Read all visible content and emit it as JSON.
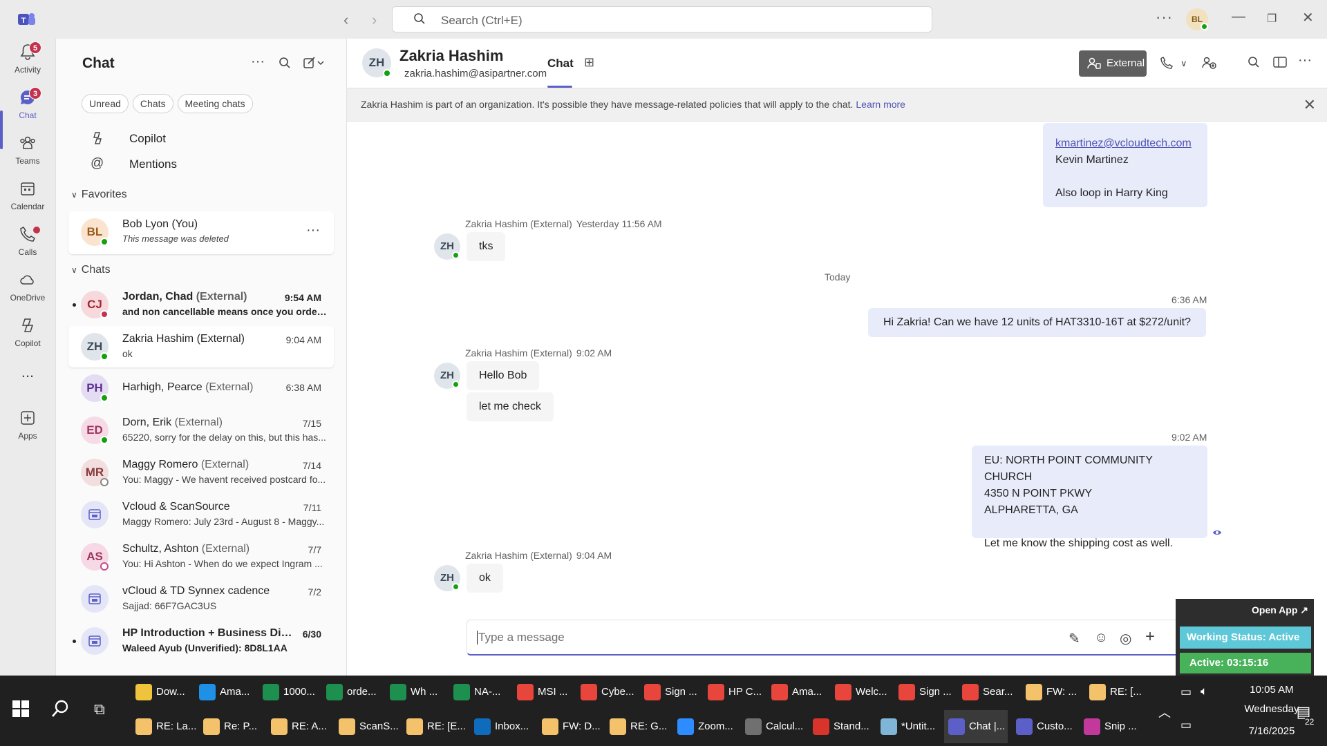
{
  "window": {
    "search_placeholder": "Search (Ctrl+E)",
    "user_initials": "BL"
  },
  "rail": {
    "items": [
      {
        "label": "Activity",
        "badge": "5"
      },
      {
        "label": "Chat",
        "badge": "3"
      },
      {
        "label": "Teams"
      },
      {
        "label": "Calendar"
      },
      {
        "label": "Calls"
      },
      {
        "label": "OneDrive"
      },
      {
        "label": "Copilot"
      },
      {
        "label": "..."
      },
      {
        "label": "Apps"
      }
    ]
  },
  "chatlist": {
    "title": "Chat",
    "filters": [
      "Unread",
      "Chats",
      "Meeting chats"
    ],
    "copilot": "Copilot",
    "mentions": "Mentions",
    "favorites_label": "Favorites",
    "chats_label": "Chats",
    "favorites": [
      {
        "initials": "BL",
        "name": "Bob Lyon (You)",
        "preview": "This message was deleted"
      }
    ],
    "chats": [
      {
        "initials": "CJ",
        "name": "Jordan, Chad",
        "ext": "(External)",
        "time": "9:54 AM",
        "preview": "and non cancellable means once you order, i..."
      },
      {
        "initials": "ZH",
        "name": "Zakria Hashim",
        "ext": "(External)",
        "time": "9:04 AM",
        "preview": "ok"
      },
      {
        "initials": "PH",
        "name": "Harhigh, Pearce",
        "ext": "(External)",
        "time": "6:38 AM",
        "preview": ""
      },
      {
        "initials": "ED",
        "name": "Dorn, Erik",
        "ext": "(External)",
        "time": "7/15",
        "preview": "65220, sorry for the delay on this, but this has..."
      },
      {
        "initials": "MR",
        "name": "Maggy Romero",
        "ext": "(External)",
        "time": "7/14",
        "preview": "You: Maggy - We havent received postcard fo..."
      },
      {
        "initials": "",
        "name": "Vcloud & ScanSource",
        "ext": "",
        "time": "7/11",
        "preview": "Maggy Romero: July 23rd - August 8 - Maggy..."
      },
      {
        "initials": "AS",
        "name": "Schultz, Ashton",
        "ext": "(External)",
        "time": "7/7",
        "preview": "You: Hi Ashton -  When do we expect Ingram ..."
      },
      {
        "initials": "",
        "name": "vCloud & TD Synnex cadence",
        "ext": "",
        "time": "7/2",
        "preview": "Sajjad: 66F7GAC3US"
      },
      {
        "initials": "",
        "name": "HP Introduction + Business Dis...",
        "ext": "",
        "time": "6/30",
        "preview": "Waleed Ayub (Unverified): 8D8L1AA"
      }
    ]
  },
  "conversation": {
    "initials": "ZH",
    "name": "Zakria Hashim",
    "email": "zakria.hashim@asipartner.com",
    "tab": "Chat",
    "external_label": "External",
    "banner": "Zakria Hashim is part of an organization. It's possible they have message-related policies that will apply to the chat.",
    "banner_link": "Learn more",
    "top_bubble": {
      "email": "kmartinez@vcloudtech.com",
      "name": "Kevin Martinez",
      "note": "Also loop in Harry King"
    },
    "sender": "Zakria Hashim (External)",
    "t1": "Yesterday 11:56 AM",
    "m1": "tks",
    "today": "Today",
    "t2": "6:36 AM",
    "m2": "Hi Zakria! Can we have 12 units of HAT3310-16T at $272/unit?",
    "t3": "9:02 AM",
    "m3a": "Hello Bob",
    "m3b": "let me check",
    "t4": "9:02 AM",
    "m4": [
      "EU: NORTH POINT COMMUNITY CHURCH",
      "4350 N POINT PKWY",
      "ALPHARETTA, GA",
      "",
      "Let me know the shipping cost as well."
    ],
    "t5": "9:04 AM",
    "m5": "ok",
    "compose_placeholder": "Type a message"
  },
  "widget": {
    "open": "Open App ↗",
    "status": "Working Status: Active",
    "active": "Active: 03:15:16"
  },
  "taskbar": {
    "row1": [
      {
        "label": "Dow...",
        "color": "#f0c33c"
      },
      {
        "label": "Ama...",
        "color": "#1e90e6"
      },
      {
        "label": "1000...",
        "color": "#1d8f4e"
      },
      {
        "label": "orde...",
        "color": "#1d8f4e"
      },
      {
        "label": "Wh ...",
        "color": "#1d8f4e"
      },
      {
        "label": "NA-...",
        "color": "#1d8f4e"
      },
      {
        "label": "MSI ...",
        "color": "#e8453c"
      },
      {
        "label": "Cybe...",
        "color": "#e8453c"
      },
      {
        "label": "Sign ...",
        "color": "#e8453c"
      },
      {
        "label": "HP C...",
        "color": "#e8453c"
      },
      {
        "label": "Ama...",
        "color": "#e8453c"
      },
      {
        "label": "Welc...",
        "color": "#e8453c"
      },
      {
        "label": "Sign ...",
        "color": "#e8453c"
      },
      {
        "label": "Sear...",
        "color": "#e8453c"
      },
      {
        "label": "FW: ...",
        "color": "#f4c26b"
      },
      {
        "label": "RE: [...",
        "color": "#f4c26b"
      }
    ],
    "row2": [
      {
        "label": "RE: La...",
        "color": "#f4c26b"
      },
      {
        "label": "Re: P...",
        "color": "#f4c26b"
      },
      {
        "label": "RE: A...",
        "color": "#f4c26b"
      },
      {
        "label": "ScanS...",
        "color": "#f4c26b"
      },
      {
        "label": "RE: [E...",
        "color": "#f4c26b"
      },
      {
        "label": "Inbox...",
        "color": "#0f6cbd"
      },
      {
        "label": "FW: D...",
        "color": "#f4c26b"
      },
      {
        "label": "RE: G...",
        "color": "#f4c26b"
      },
      {
        "label": "Zoom...",
        "color": "#2d8cff"
      },
      {
        "label": "Calcul...",
        "color": "#707070"
      },
      {
        "label": "Stand...",
        "color": "#d9342b"
      },
      {
        "label": "*Untit...",
        "color": "#7fb5d6"
      },
      {
        "label": "Chat |...",
        "color": "#5b5fc7"
      },
      {
        "label": "Custo...",
        "color": "#5b5fc7"
      },
      {
        "label": "Snip ...",
        "color": "#c2399b"
      }
    ],
    "time": "10:05 AM",
    "day": "Wednesday",
    "date": "7/16/2025",
    "notif": "22"
  }
}
